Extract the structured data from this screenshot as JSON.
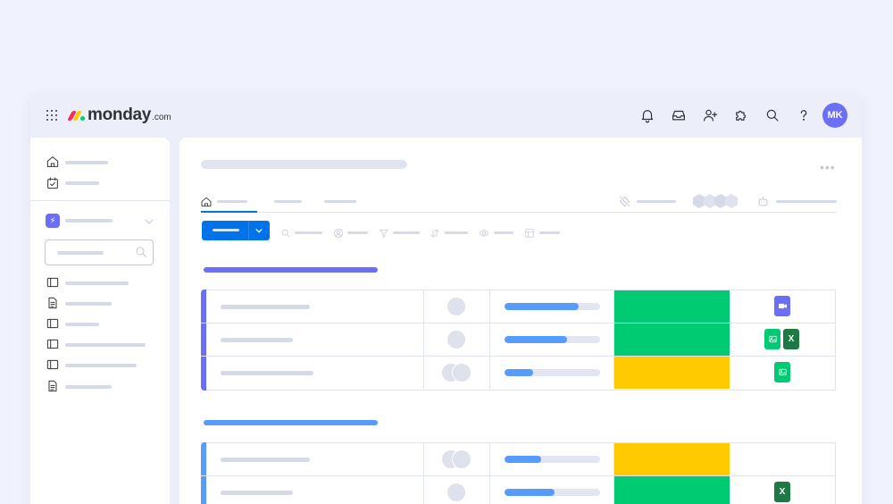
{
  "app": {
    "logo_text": "monday",
    "logo_suffix": ".com",
    "user_initials": "MK"
  },
  "colors": {
    "brand_blue": "#0073ea",
    "done_green": "#00ca72",
    "working_yellow": "#ffcb00",
    "progress_blue": "#579bfc",
    "group_purple": "#6b6ff5",
    "group_blue": "#579bfc",
    "excel_green": "#1e7a45"
  },
  "topbar": {
    "icons": [
      "notifications-icon",
      "inbox-icon",
      "invite-user-icon",
      "apps-icon",
      "search-icon",
      "help-icon"
    ]
  },
  "board": {
    "groups": [
      {
        "color": "#6b6ff5",
        "rows": [
          {
            "progress": 0.78,
            "status_color": "#00ca72",
            "people": 1,
            "files": [
              "video"
            ]
          },
          {
            "progress": 0.65,
            "status_color": "#00ca72",
            "people": 1,
            "files": [
              "image",
              "excel"
            ]
          },
          {
            "progress": 0.3,
            "status_color": "#ffcb00",
            "people": 2,
            "files": [
              "image"
            ]
          }
        ]
      },
      {
        "color": "#579bfc",
        "rows": [
          {
            "progress": 0.38,
            "status_color": "#ffcb00",
            "people": 2,
            "files": []
          },
          {
            "progress": 0.52,
            "status_color": "#00ca72",
            "people": 1,
            "files": [
              "excel"
            ]
          }
        ]
      }
    ],
    "excel_letter": "X"
  }
}
